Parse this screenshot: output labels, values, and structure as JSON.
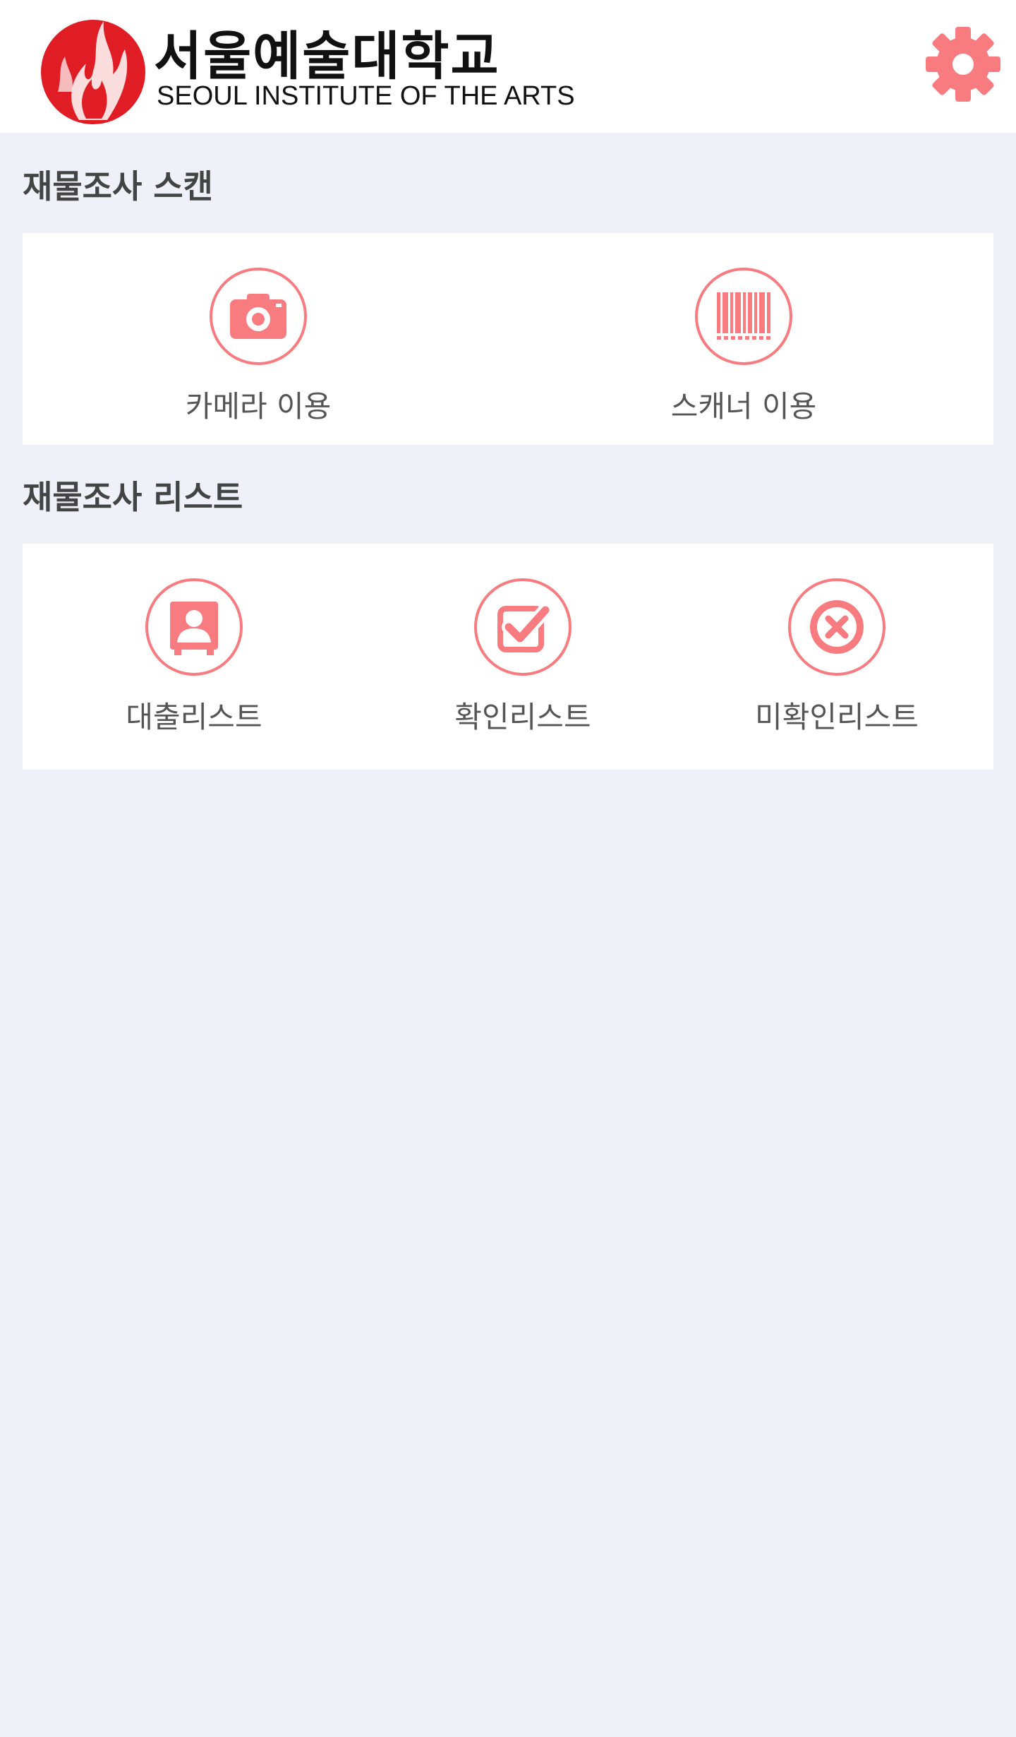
{
  "header": {
    "logo_korean": "서울예술대학교",
    "logo_english": "SEOUL INSTITUTE OF THE ARTS",
    "settings_icon": "gear-icon"
  },
  "scan_section": {
    "title": "재물조사 스캔",
    "items": [
      {
        "label": "카메라 이용",
        "icon": "camera-icon"
      },
      {
        "label": "스캐너 이용",
        "icon": "barcode-icon"
      }
    ]
  },
  "list_section": {
    "title": "재물조사 리스트",
    "items": [
      {
        "label": "대출리스트",
        "icon": "contact-card-icon"
      },
      {
        "label": "확인리스트",
        "icon": "checkbox-icon"
      },
      {
        "label": "미확인리스트",
        "icon": "x-circle-icon"
      }
    ]
  },
  "colors": {
    "accent": "#f77b7f",
    "logo_red": "#e01c24",
    "background": "#f0f1f8"
  }
}
